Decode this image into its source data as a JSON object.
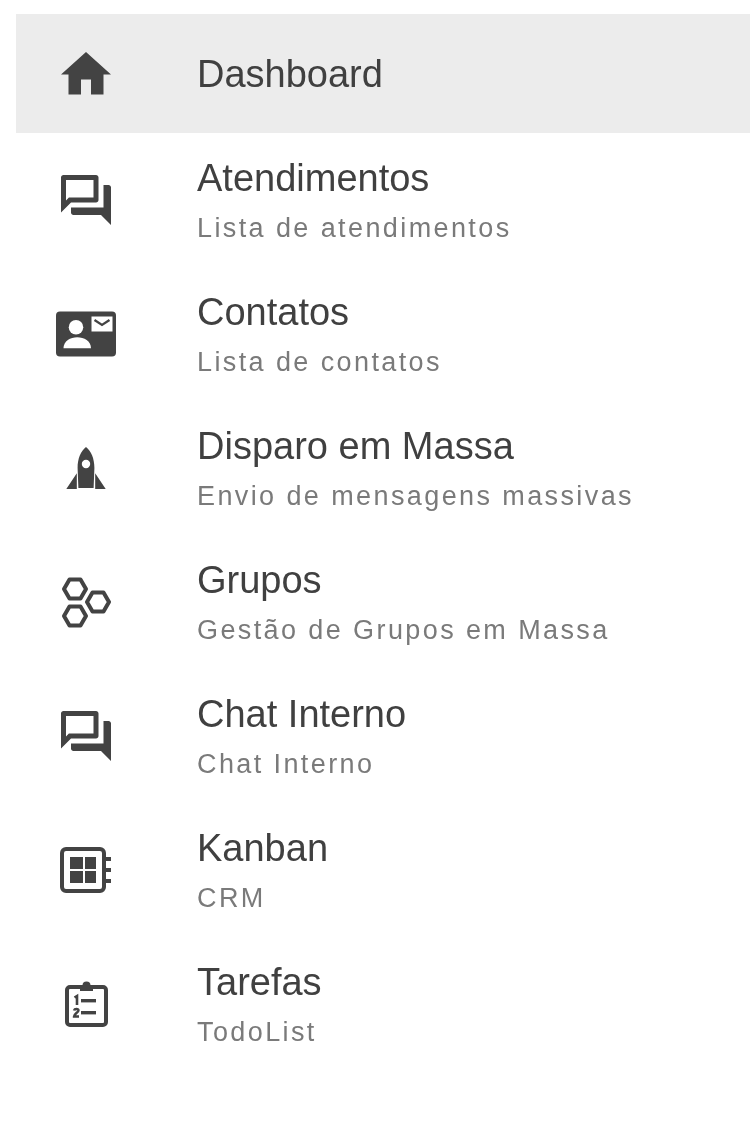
{
  "sidebar": {
    "items": [
      {
        "title": "Dashboard",
        "selected": true
      },
      {
        "title": "Atendimentos",
        "subtitle": "Lista de atendimentos",
        "selected": false
      },
      {
        "title": "Contatos",
        "subtitle": "Lista de contatos",
        "selected": false
      },
      {
        "title": "Disparo em Massa",
        "subtitle": "Envio de mensagens massivas",
        "selected": false
      },
      {
        "title": "Grupos",
        "subtitle": "Gestão de Grupos em Massa",
        "selected": false
      },
      {
        "title": "Chat Interno",
        "subtitle": "Chat Interno",
        "selected": false
      },
      {
        "title": "Kanban",
        "subtitle": "CRM",
        "selected": false
      },
      {
        "title": "Tarefas",
        "subtitle": "TodoList",
        "selected": false
      }
    ]
  }
}
